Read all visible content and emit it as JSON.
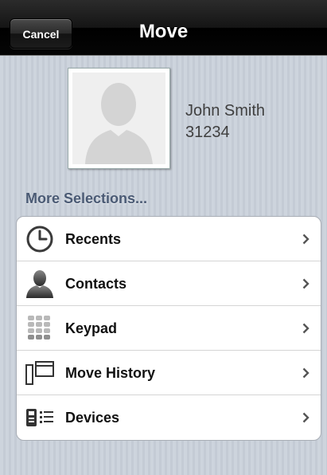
{
  "navbar": {
    "cancel_label": "Cancel",
    "title": "Move"
  },
  "contact": {
    "name": "John Smith",
    "number": "31234",
    "avatar_icon": "person-silhouette-icon"
  },
  "section_header": "More Selections...",
  "menu": {
    "items": [
      {
        "label": "Recents",
        "icon": "clock-icon"
      },
      {
        "label": "Contacts",
        "icon": "person-icon"
      },
      {
        "label": "Keypad",
        "icon": "keypad-icon"
      },
      {
        "label": "Move History",
        "icon": "move-history-icon"
      },
      {
        "label": "Devices",
        "icon": "devices-icon"
      }
    ],
    "chevron_icon": "chevron-right-icon"
  },
  "colors": {
    "navbar": "#000000",
    "background": "#c9d0da",
    "section_header": "#4a5a74"
  }
}
